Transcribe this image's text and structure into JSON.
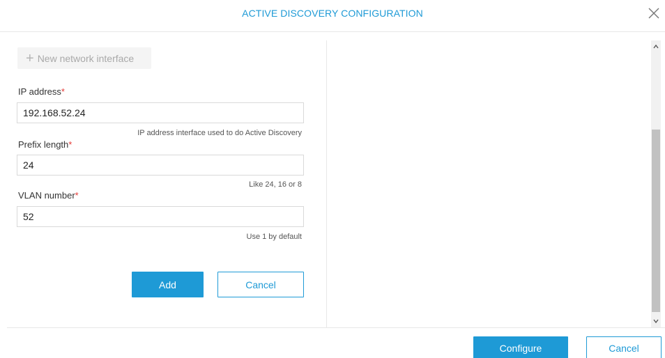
{
  "dialog": {
    "title": "ACTIVE DISCOVERY CONFIGURATION",
    "close_icon": "close-icon"
  },
  "form": {
    "new_interface_label": "New network interface",
    "new_interface_icon": "plus-icon",
    "ip_address": {
      "label": "IP address",
      "required_mark": "*",
      "value": "192.168.52.24",
      "hint": "IP address interface used to do Active Discovery"
    },
    "prefix_length": {
      "label": "Prefix length",
      "required_mark": "*",
      "value": "24",
      "hint": "Like 24, 16 or 8"
    },
    "vlan_number": {
      "label": "VLAN number",
      "required_mark": "*",
      "value": "52",
      "hint": "Use 1 by default"
    },
    "add_label": "Add",
    "cancel_label": "Cancel"
  },
  "footer": {
    "configure_label": "Configure",
    "cancel_label": "Cancel"
  },
  "colors": {
    "accent": "#1e9ad6",
    "required": "#e53935"
  }
}
